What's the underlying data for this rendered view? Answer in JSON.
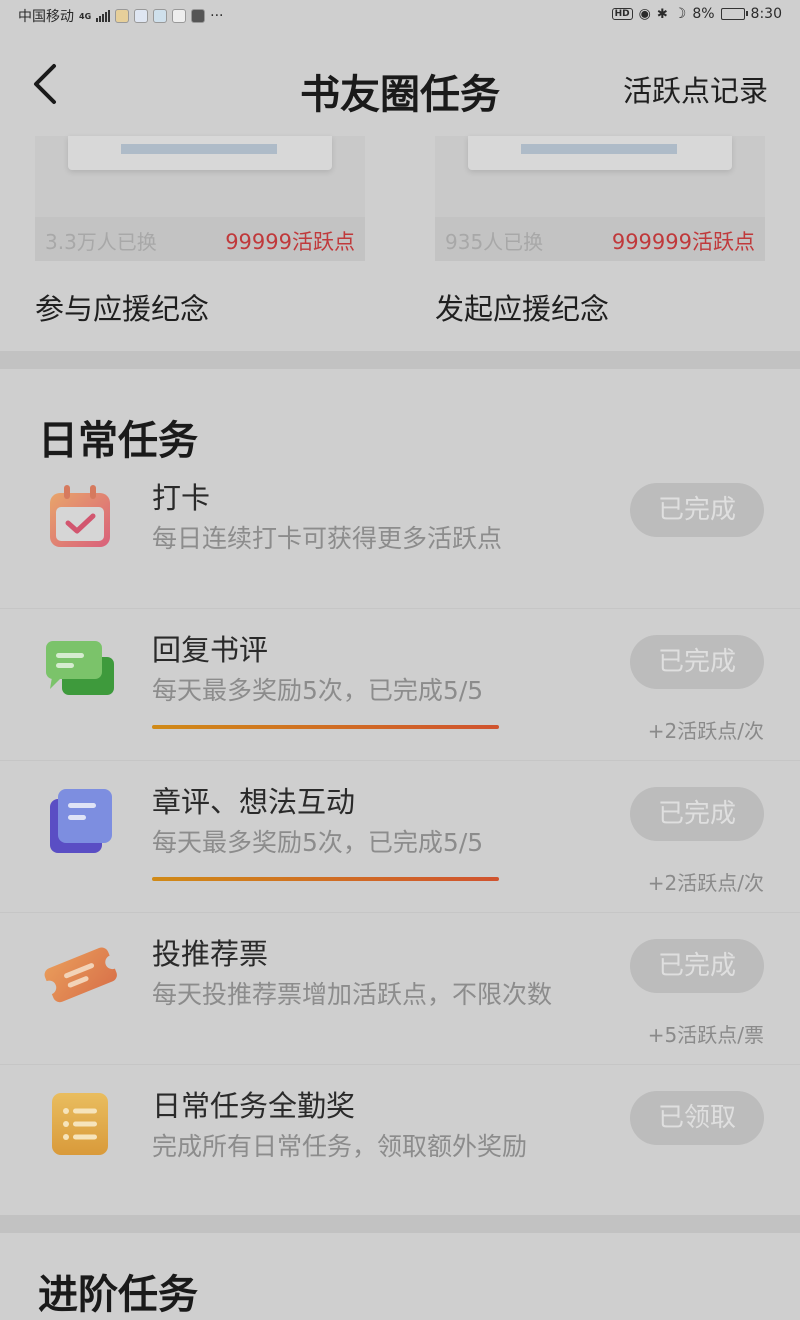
{
  "status_bar": {
    "carrier": "中国移动",
    "network": "4G",
    "more": "···",
    "battery": "8%",
    "time": "8:30"
  },
  "header": {
    "title": "书友圈任务",
    "record_link": "活跃点记录"
  },
  "reward_cards": [
    {
      "count": "3.3万人已换",
      "points": "99999活跃点",
      "name": "参与应援纪念"
    },
    {
      "count": "935人已换",
      "points": "999999活跃点",
      "name": "发起应援纪念"
    }
  ],
  "daily": {
    "title": "日常任务",
    "tasks": [
      {
        "name": "打卡",
        "desc": "每日连续打卡可获得更多活跃点",
        "button": "已完成",
        "reward": "",
        "icon": "calendar-check-icon"
      },
      {
        "name": "回复书评",
        "desc": "每天最多奖励5次，已完成5/5",
        "button": "已完成",
        "reward": "+2活跃点/次",
        "icon": "chat-bubbles-icon"
      },
      {
        "name": "章评、想法互动",
        "desc": "每天最多奖励5次，已完成5/5",
        "button": "已完成",
        "reward": "+2活跃点/次",
        "icon": "stacked-notes-icon"
      },
      {
        "name": "投推荐票",
        "desc": "每天投推荐票增加活跃点，不限次数",
        "button": "已完成",
        "reward": "+5活跃点/票",
        "icon": "ticket-icon"
      },
      {
        "name": "日常任务全勤奖",
        "desc": "完成所有日常任务，领取额外奖励",
        "button": "已领取",
        "reward": "",
        "icon": "checklist-icon"
      }
    ]
  },
  "next_section_title": "进阶任务"
}
